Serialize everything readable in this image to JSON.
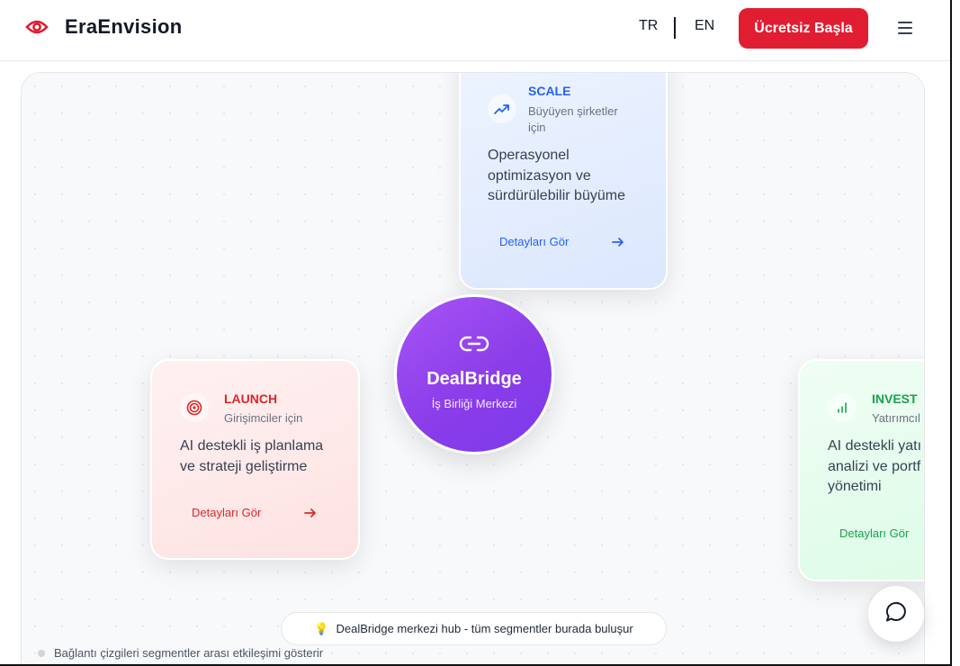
{
  "brand": {
    "name": "EraEnvision",
    "accent": "#e11d32"
  },
  "nav": {
    "lang_tr": "TR",
    "lang_en": "EN",
    "cta_label": "Ücretsiz Başla",
    "menu_icon": "hamburger-menu-icon"
  },
  "cards": {
    "scale": {
      "title": "SCALE",
      "subtitle_line1": "Büyüyen şirketler",
      "subtitle_line2": "için",
      "desc_line1": "Operasyonel",
      "desc_line2": "optimizasyon ve",
      "desc_line3": "sürdürülebilir büyüme",
      "link": "Detayları Gör",
      "color": "#2563eb",
      "icon": "trending-up-icon"
    },
    "launch": {
      "title": "LAUNCH",
      "subtitle": "Girişimciler için",
      "desc_line1": "AI destekli iş planlama",
      "desc_line2": "ve strateji geliştirme",
      "link": "Detayları Gör",
      "color": "#dc2626",
      "icon": "target-icon"
    },
    "invest": {
      "title": "INVEST",
      "subtitle": "Yatırımcıl",
      "desc_line1": "AI destekli yatı",
      "desc_line2": "analizi ve portf",
      "desc_line3": "yönetimi",
      "link": "Detayları Gör",
      "color": "#16a34a",
      "icon": "bar-chart-icon"
    }
  },
  "hub": {
    "title": "DealBridge",
    "subtitle": "İş Birliği Merkezi",
    "icon": "link-icon",
    "color": "#9333ea"
  },
  "tip": {
    "icon": "💡",
    "text": "DealBridge merkezi hub - tüm segmentler burada buluşur"
  },
  "legend": {
    "text": "Bağlantı çizgileri segmentler arası etkileşimi gösterir"
  },
  "chat": {
    "icon": "chat-bubble-icon"
  }
}
